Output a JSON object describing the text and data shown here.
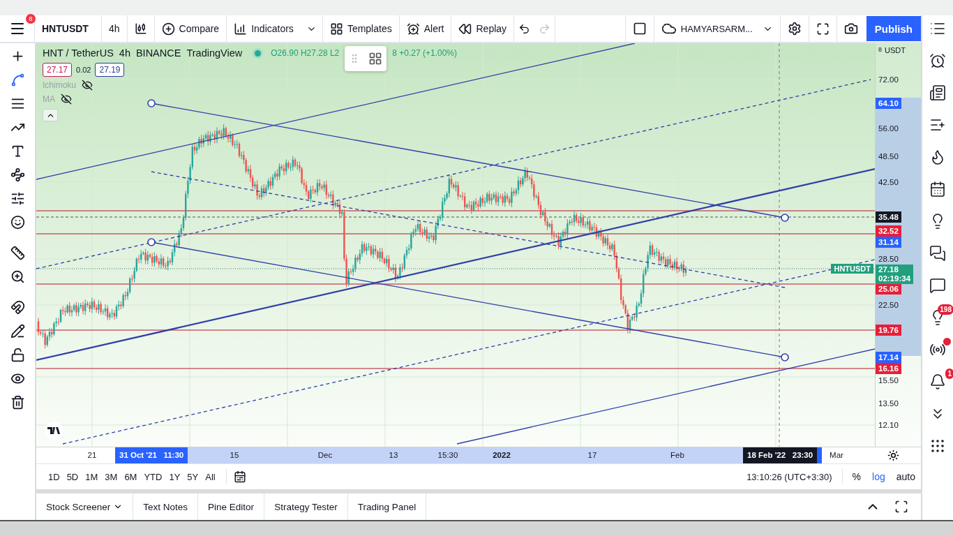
{
  "toolbar": {
    "menu_badge": "8",
    "symbol": "HNTUSDT",
    "interval": "4h",
    "buttons": [
      {
        "label": "Compare",
        "kind": "compare"
      },
      {
        "label": "Indicators",
        "kind": "indicators"
      },
      {
        "label": "Templates",
        "kind": "templates"
      },
      {
        "label": "Alert",
        "kind": "alert"
      },
      {
        "label": "Replay",
        "kind": "replay"
      }
    ],
    "redo": {
      "disabled": true
    },
    "layout_name": "HAMYARSARM...",
    "publish": "Publish"
  },
  "drawing_tools": [
    {
      "kind": "crosshair",
      "selected": false
    },
    {
      "kind": "trend",
      "selected": true
    },
    {
      "kind": "fib",
      "selected": false
    },
    {
      "kind": "brush",
      "selected": false
    },
    {
      "kind": "text",
      "selected": false
    },
    {
      "kind": "pattern",
      "selected": false
    },
    {
      "kind": "forecast",
      "selected": false
    },
    {
      "kind": "emoji",
      "selected": false
    },
    {
      "kind": "ruler",
      "selected": false
    },
    {
      "kind": "zoom",
      "selected": false
    },
    {
      "kind": "magnet",
      "selected": false
    },
    {
      "kind": "stay",
      "selected": false
    },
    {
      "kind": "lock",
      "selected": false
    },
    {
      "kind": "hide",
      "selected": false
    },
    {
      "kind": "trash",
      "selected": false
    }
  ],
  "legend": {
    "title_parts": [
      "HNT / TetherUS",
      "4h",
      "BINANCE",
      "TradingView"
    ],
    "ohlc_head": "O26.90 H27.28 L2",
    "ohlc_tail": "8 +0.27 (+1.00%)",
    "bid": "27.17",
    "spread": "0.02",
    "ask": "27.19",
    "indicators": [
      {
        "name": "Ichimoku",
        "visible": false
      },
      {
        "name": "MA",
        "visible": false
      }
    ]
  },
  "symbol_tag": "HNTUSDT",
  "price_axis": {
    "unit_prefix": "8",
    "currency": "USDT",
    "labels": [
      {
        "text": "72.00",
        "kind": "plain"
      },
      {
        "text": "64.10",
        "kind": "blue"
      },
      {
        "text": "56.00",
        "kind": "plain"
      },
      {
        "text": "48.50",
        "kind": "plain"
      },
      {
        "text": "42.50",
        "kind": "plain"
      },
      {
        "text": "35.48",
        "kind": "black"
      },
      {
        "text": "32.52",
        "kind": "red"
      },
      {
        "text": "31.14",
        "kind": "blue"
      },
      {
        "text": "28.50",
        "kind": "plain"
      },
      {
        "text": "27.18",
        "kind": "last",
        "sub": "02:19:34"
      },
      {
        "text": "25.06",
        "kind": "red"
      },
      {
        "text": "22.50",
        "kind": "plain"
      },
      {
        "text": "19.76",
        "kind": "red"
      },
      {
        "text": "17.14",
        "kind": "blue"
      },
      {
        "text": "16.16",
        "kind": "red"
      },
      {
        "text": "15.50",
        "kind": "plain"
      },
      {
        "text": "13.50",
        "kind": "plain"
      },
      {
        "text": "12.10",
        "kind": "plain"
      }
    ]
  },
  "time_axis": [
    {
      "text": "21",
      "kind": "plain"
    },
    {
      "text": "31 Oct '21   11:30",
      "kind": "start"
    },
    {
      "text": "15",
      "kind": "plain"
    },
    {
      "text": "Dec",
      "kind": "plain"
    },
    {
      "text": "13",
      "kind": "plain"
    },
    {
      "text": "15:30",
      "kind": "plain"
    },
    {
      "text": "2022",
      "kind": "bold"
    },
    {
      "text": "17",
      "kind": "plain"
    },
    {
      "text": "Feb",
      "kind": "plain"
    },
    {
      "text": "18 Feb '22   23:30",
      "kind": "cursor"
    },
    {
      "text": "Mar",
      "kind": "plain"
    }
  ],
  "ranges": [
    "1D",
    "5D",
    "1M",
    "3M",
    "6M",
    "YTD",
    "1Y",
    "5Y",
    "All"
  ],
  "clock": "13:10:26 (UTC+3:30)",
  "scale_options": [
    {
      "label": "%",
      "selected": false
    },
    {
      "label": "log",
      "selected": true
    },
    {
      "label": "auto",
      "selected": false
    }
  ],
  "bottom_tabs": [
    {
      "label": "Stock Screener",
      "has_menu": true
    },
    {
      "label": "Text Notes",
      "has_menu": false
    },
    {
      "label": "Pine Editor",
      "has_menu": false
    },
    {
      "label": "Strategy Tester",
      "has_menu": false
    },
    {
      "label": "Trading Panel",
      "has_menu": false
    }
  ],
  "sidebar": [
    {
      "kind": "watchlist",
      "dot": false
    },
    {
      "kind": "alerts",
      "dot": false
    },
    {
      "kind": "news",
      "dot": false
    },
    {
      "kind": "details",
      "dot": false
    },
    {
      "kind": "hotlist",
      "dot": false
    },
    {
      "kind": "calendar",
      "dot": false
    },
    {
      "kind": "ideas",
      "dot": false
    },
    {
      "kind": "chats",
      "dot": false
    },
    {
      "kind": "chat",
      "dot": false
    },
    {
      "kind": "ideas_stream",
      "badge": "198",
      "dot": false
    },
    {
      "kind": "streams",
      "dot": true
    },
    {
      "kind": "notifications",
      "badge": "1",
      "dot": false
    },
    {
      "kind": "chevrons",
      "dot": false
    },
    {
      "kind": "dots",
      "dot": false
    }
  ]
}
